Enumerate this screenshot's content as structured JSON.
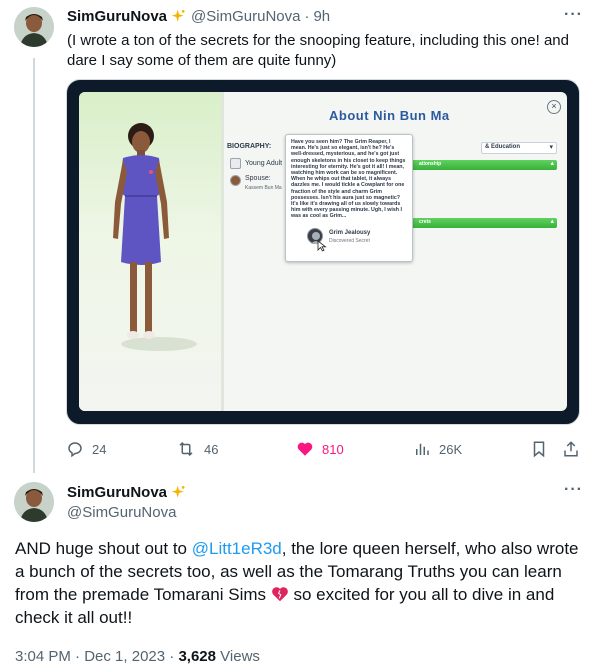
{
  "tweet1": {
    "display_name": "SimGuruNova",
    "handle": "@SimGuruNova",
    "separator": "·",
    "time": "9h",
    "more": "···",
    "text": "(I wrote a ton of the secrets for the snooping feature, including this one! and dare I say some of them are quite funny)",
    "media": {
      "title": "About Nin Bun Ma",
      "close": "×",
      "biography_label": "BIOGRAPHY:",
      "age_label": "Young Adult",
      "spouse_label": "Spouse:",
      "spouse_name": "Kassem Bun Ma",
      "dropdown_label": "& Education",
      "bar1_label": "ationship",
      "bar2_label": "crets",
      "tooltip_text": "Have you seen him? The Grim Reaper, I mean. He's just so elegant, isn't he? He's well-dressed, mysterious, and he's got just enough skeletons in his closet to keep things interesting for eternity. He's got it all! I mean, watching him work can be so magnificent. When he whips out that tablet, it always dazzles me. I would tickle a Cowplant for one fraction of the style and charm Grim possesses. Isn't his aura just so magnetic? It's like it's drawing all of us slowly towards him with every passing minute. Ugh, I wish I was as cool as Grim...",
      "secret_name": "Grim Jealousy",
      "secret_status": "Discovered Secret"
    },
    "actions": {
      "replies": "24",
      "reposts": "46",
      "likes": "810",
      "views": "26K"
    }
  },
  "tweet2": {
    "display_name": "SimGuruNova",
    "handle": "@SimGuruNova",
    "more": "···",
    "text_before_mention": "AND huge shout out to ",
    "mention": "@Litt1eR3d",
    "text_after_mention": ", the lore queen herself, who also wrote a bunch of the secrets too, as well as the Tomarang Truths you can learn from the premade Tomarani Sims ",
    "text_after_emoji": " so excited for you all to dive in and check it all out!!",
    "time": "3:04 PM",
    "dot": "·",
    "date": "Dec 1, 2023",
    "views_count": "3,628",
    "views_label": "Views"
  },
  "colors": {
    "link": "#1d9bf0",
    "like": "#f91880",
    "secondary_text": "#536471",
    "game_title": "#2c5aa0",
    "game_green": "#38b038"
  }
}
